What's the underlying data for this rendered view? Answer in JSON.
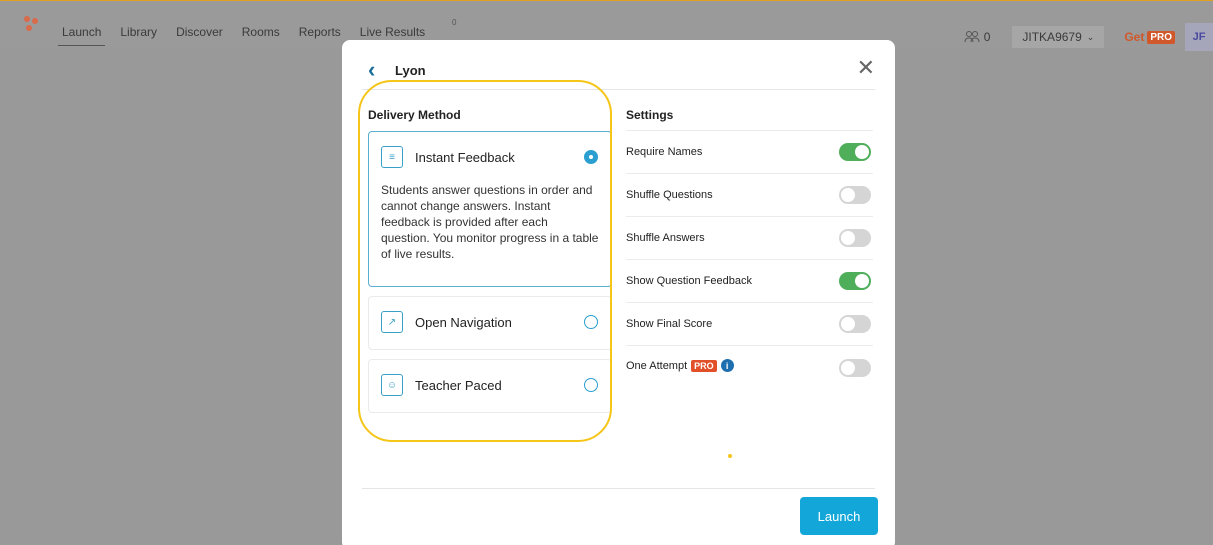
{
  "nav": {
    "items": [
      "Launch",
      "Library",
      "Discover",
      "Rooms",
      "Reports",
      "Live Results"
    ],
    "live_indicator": "0"
  },
  "header_right": {
    "user_count": "0",
    "account": "JITKA9679",
    "get_label": "Get",
    "pro_badge": "PRO",
    "avatar_initials": "JF"
  },
  "modal": {
    "title": "Lyon",
    "delivery_title": "Delivery Method",
    "options": [
      {
        "label": "Instant Feedback",
        "icon": "instant-feedback-icon",
        "selected": true,
        "desc": "Students answer questions in order and cannot change answers. Instant feedback is provided after each question. You monitor progress in a table of live results."
      },
      {
        "label": "Open Navigation",
        "icon": "open-navigation-icon",
        "selected": false
      },
      {
        "label": "Teacher Paced",
        "icon": "teacher-paced-icon",
        "selected": false
      }
    ],
    "settings_title": "Settings",
    "settings": [
      {
        "label": "Require Names",
        "on": true
      },
      {
        "label": "Shuffle Questions",
        "on": false
      },
      {
        "label": "Shuffle Answers",
        "on": false
      },
      {
        "label": "Show Question Feedback",
        "on": true
      },
      {
        "label": "Show Final Score",
        "on": false
      },
      {
        "label": "One Attempt",
        "on": false,
        "pro": "PRO"
      }
    ],
    "launch_label": "Launch"
  },
  "colors": {
    "accent": "#12a7d8",
    "toggle_on": "#4fae5a",
    "highlight": "#f5c518",
    "pro": "#e2502a"
  }
}
